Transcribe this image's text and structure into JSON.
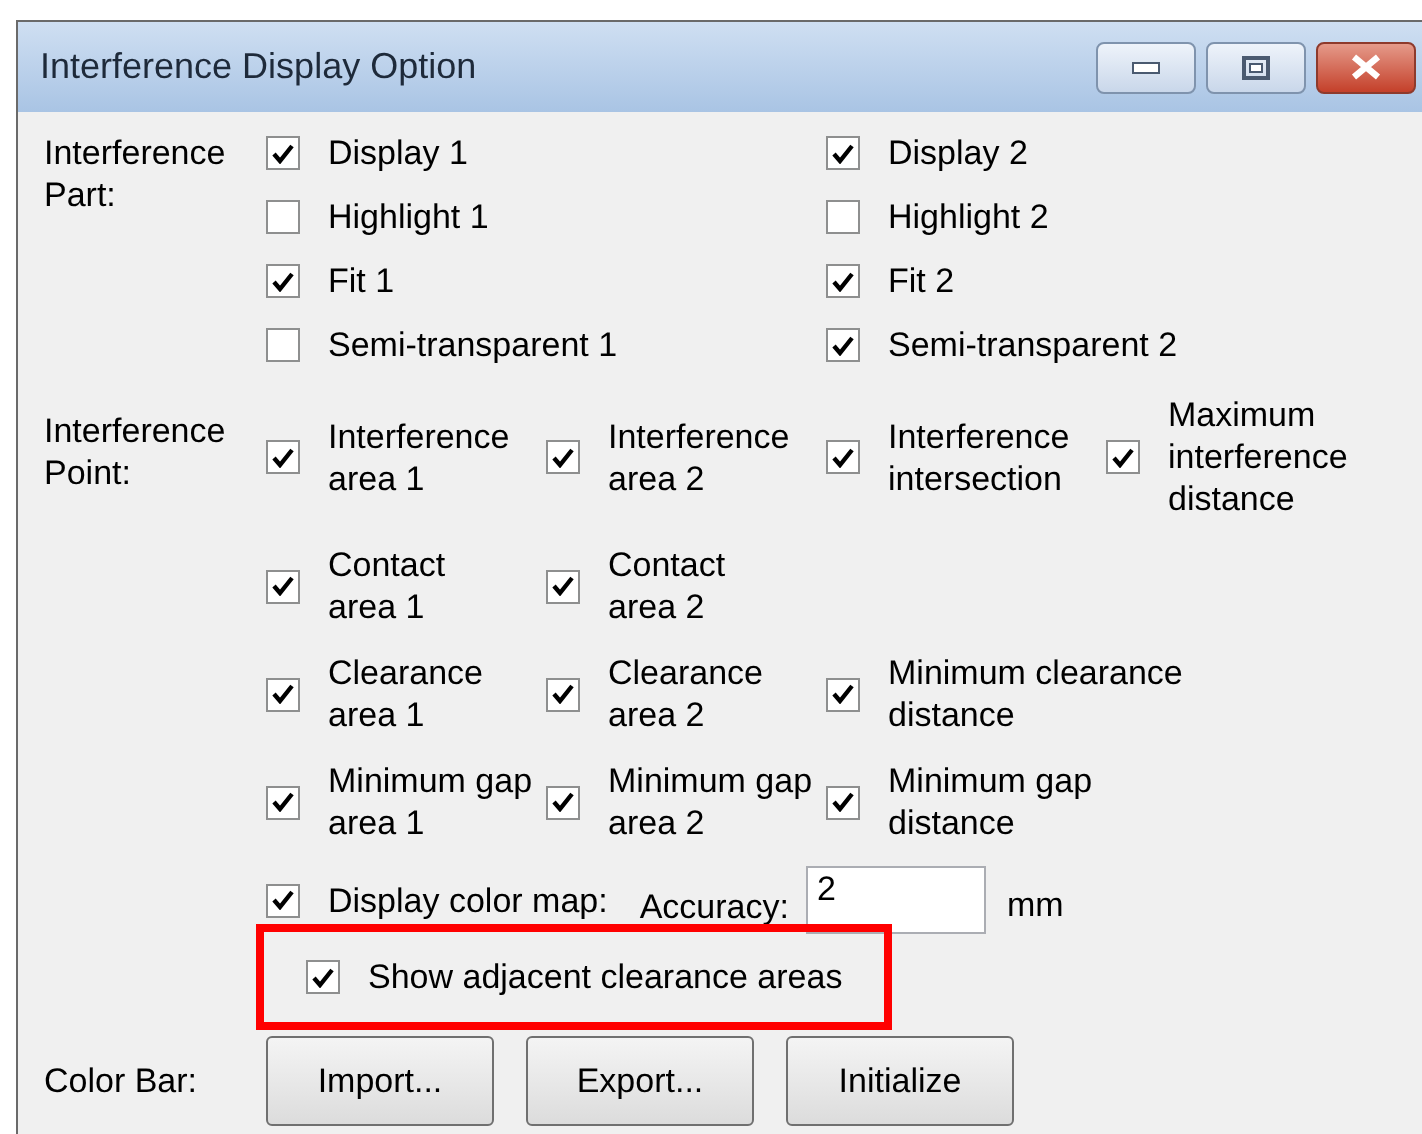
{
  "window": {
    "title": "Interference Display Option"
  },
  "title_buttons": [
    {
      "kind": "minimize"
    },
    {
      "kind": "maximize"
    },
    {
      "kind": "close"
    }
  ],
  "part": {
    "label": "Interference Part:",
    "items": [
      {
        "text": "Display 1",
        "checked": true
      },
      {
        "text": "Display 2",
        "checked": true
      },
      {
        "text": "Highlight 1",
        "checked": false
      },
      {
        "text": "Highlight 2",
        "checked": false
      },
      {
        "text": "Fit 1",
        "checked": true
      },
      {
        "text": "Fit 2",
        "checked": true
      },
      {
        "text": "Semi-transparent 1",
        "checked": false
      },
      {
        "text": "Semi-transparent 2",
        "checked": true
      }
    ]
  },
  "point": {
    "label": "Interference Point:",
    "rows": [
      [
        {
          "text": "Interference\narea 1",
          "checked": true
        },
        {
          "text": "Interference\narea 2",
          "checked": true
        },
        {
          "text": "Interference\nintersection",
          "checked": true
        },
        {
          "text": "Maximum\ninterference\ndistance",
          "checked": true
        }
      ],
      [
        {
          "text": "Contact\narea 1",
          "checked": true
        },
        {
          "text": "Contact\narea 2",
          "checked": true
        }
      ],
      [
        {
          "text": "Clearance\narea 1",
          "checked": true
        },
        {
          "text": "Clearance\narea 2",
          "checked": true
        },
        {
          "text": "Minimum clearance\ndistance",
          "checked": true
        }
      ],
      [
        {
          "text": "Minimum gap\narea 1",
          "checked": true
        },
        {
          "text": "Minimum gap\narea 2",
          "checked": true
        },
        {
          "text": "Minimum gap\ndistance",
          "checked": true
        }
      ]
    ]
  },
  "color_map": {
    "text": "Display color map:",
    "checked": true,
    "accuracy_label": "Accuracy:",
    "accuracy_value": "2",
    "unit": "mm"
  },
  "adjacent": {
    "text": "Show adjacent clearance areas",
    "checked": true,
    "highlighted": true
  },
  "color_bar": {
    "label": "Color Bar:",
    "buttons": [
      "Import...",
      "Export...",
      "Initialize"
    ]
  }
}
